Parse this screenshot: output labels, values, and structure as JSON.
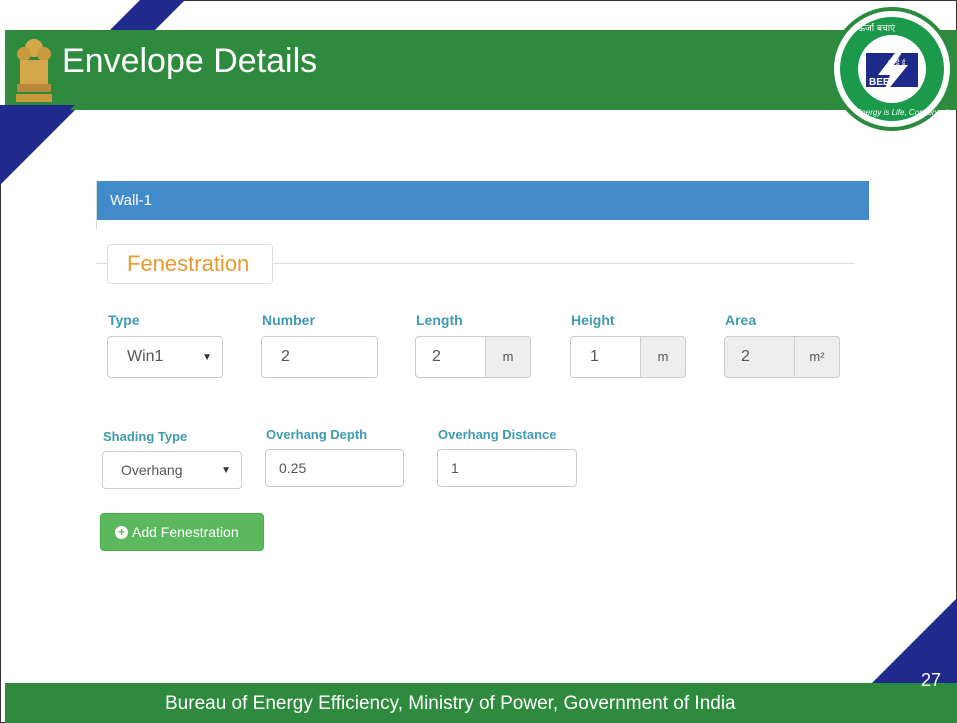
{
  "slide": {
    "title": "Envelope Details",
    "footer": "Bureau of Energy Efficiency, Ministry of Power, Government of India",
    "page_number": "27",
    "logo_text_top": "ऊर्जा बचाएं",
    "logo_center": "बी ई ई",
    "logo_bee": "BEE",
    "logo_bottom": "Energy is Life, Conserve it"
  },
  "panel": {
    "heading": "Wall-1"
  },
  "fenestration": {
    "legend": "Fenestration",
    "type": {
      "label": "Type",
      "value": "Win1"
    },
    "number": {
      "label": "Number",
      "value": "2"
    },
    "length": {
      "label": "Length",
      "value": "2",
      "unit": "m"
    },
    "height": {
      "label": "Height",
      "value": "1",
      "unit": "m"
    },
    "area": {
      "label": "Area",
      "value": "2",
      "unit": "m²"
    },
    "shading_type": {
      "label": "Shading Type",
      "value": "Overhang"
    },
    "overhang_depth": {
      "label": "Overhang Depth",
      "value": "0.25"
    },
    "overhang_distance": {
      "label": "Overhang Distance",
      "value": "1"
    },
    "add_button": "Add Fenestration"
  },
  "colors": {
    "green": "#2e8b3e",
    "navy": "#1f2a8c",
    "panel_blue": "#428bca",
    "label_teal": "#3e9bb0",
    "legend_orange": "#e89a2c",
    "button_green": "#5cb85c"
  },
  "icons": {
    "emblem": "national-emblem-icon",
    "logo": "bee-logo",
    "add": "plus-circle-icon",
    "select": "caret-down-icon"
  }
}
